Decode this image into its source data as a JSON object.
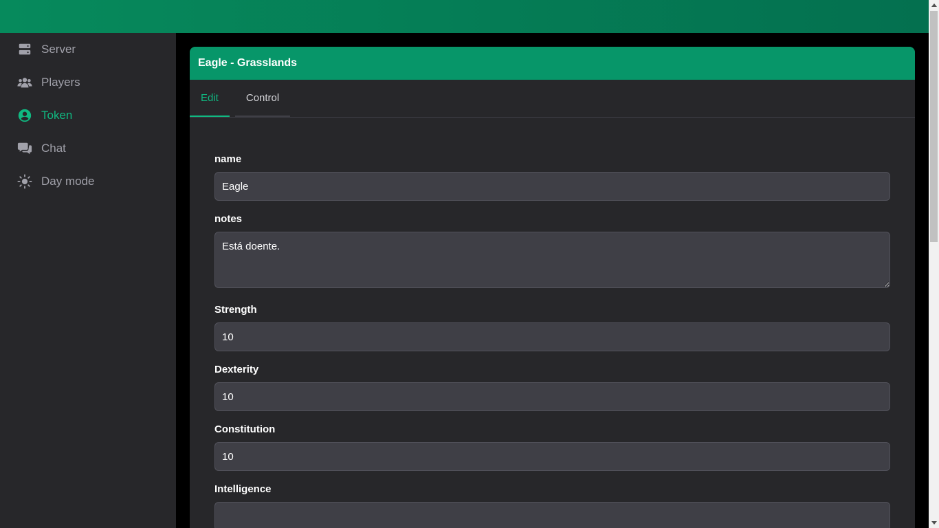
{
  "colors": {
    "accent": "#10b981",
    "header": "#079669",
    "panel": "#27272a",
    "input": "#3f3f46"
  },
  "sidebar": {
    "items": [
      {
        "label": "Server",
        "icon": "server-icon",
        "active": false
      },
      {
        "label": "Players",
        "icon": "users-icon",
        "active": false
      },
      {
        "label": "Token",
        "icon": "user-circle-icon",
        "active": true
      },
      {
        "label": "Chat",
        "icon": "comments-icon",
        "active": false
      },
      {
        "label": "Day mode",
        "icon": "sun-icon",
        "active": false
      }
    ]
  },
  "card": {
    "title": "Eagle - Grasslands",
    "tabs": [
      {
        "label": "Edit",
        "active": true
      },
      {
        "label": "Control",
        "active": false
      }
    ]
  },
  "form": {
    "name": {
      "label": "name",
      "value": "Eagle"
    },
    "notes": {
      "label": "notes",
      "value": "Está doente."
    },
    "strength": {
      "label": "Strength",
      "value": "10"
    },
    "dexterity": {
      "label": "Dexterity",
      "value": "10"
    },
    "constitution": {
      "label": "Constitution",
      "value": "10"
    },
    "intelligence": {
      "label": "Intelligence",
      "value": ""
    }
  }
}
